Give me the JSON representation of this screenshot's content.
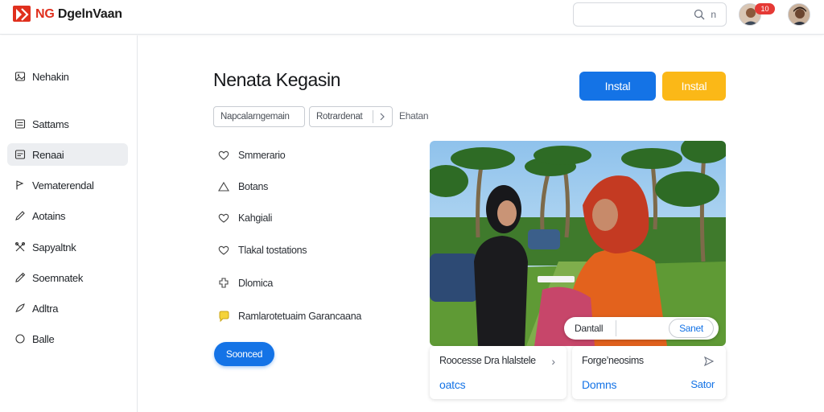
{
  "header": {
    "brand_prefix": "NG",
    "brand_name": "DgelnVaan",
    "search_text": "n",
    "notification_count": "10"
  },
  "sidebar": {
    "items": [
      {
        "label": "Nehakin",
        "icon": "image-icon"
      },
      {
        "label": "Sattams",
        "icon": "grid-icon"
      },
      {
        "label": "Renaai",
        "icon": "list-icon",
        "active": true
      },
      {
        "label": "Vematerendal",
        "icon": "flag-icon"
      },
      {
        "label": "Aotains",
        "icon": "pencil-icon"
      },
      {
        "label": "Sapyaltnk",
        "icon": "tools-icon"
      },
      {
        "label": "Soemnatek",
        "icon": "pen-icon"
      },
      {
        "label": "Adltra",
        "icon": "feather-icon"
      },
      {
        "label": "Balle",
        "icon": "circle-icon"
      }
    ]
  },
  "main": {
    "title": "Nenata Kegasin",
    "primary_button": "Instal",
    "secondary_button": "Instal",
    "filters": {
      "chip1": "Napcalarngemain",
      "chip2": "Rotrardenat",
      "link": "Ehatan"
    },
    "features": [
      {
        "label": "Smmerario",
        "icon": "heart-outline-icon"
      },
      {
        "label": "Botans",
        "icon": "triangle-icon"
      },
      {
        "label": "Kahgiali",
        "icon": "heart-icon"
      },
      {
        "label": "Tlakal tostations",
        "icon": "heart-icon"
      },
      {
        "label": "Dlomica",
        "icon": "puzzle-icon"
      },
      {
        "label": "Ramlarotetuaim Garancaana",
        "icon": "chat-icon"
      }
    ],
    "pill_button": "Soonced"
  },
  "photo_card": {
    "overlay_label": "Dantall",
    "overlay_action": "Sanet"
  },
  "cards": [
    {
      "title": "Roocesse Dra hlalstele",
      "value": "oatcs"
    },
    {
      "title": "Forge’neosims",
      "value": "Domns",
      "link": "Sator"
    }
  ],
  "colors": {
    "accent_blue": "#1473e6",
    "accent_yellow": "#fbb817",
    "brand_red": "#e0301e",
    "badge_red": "#e53935"
  }
}
